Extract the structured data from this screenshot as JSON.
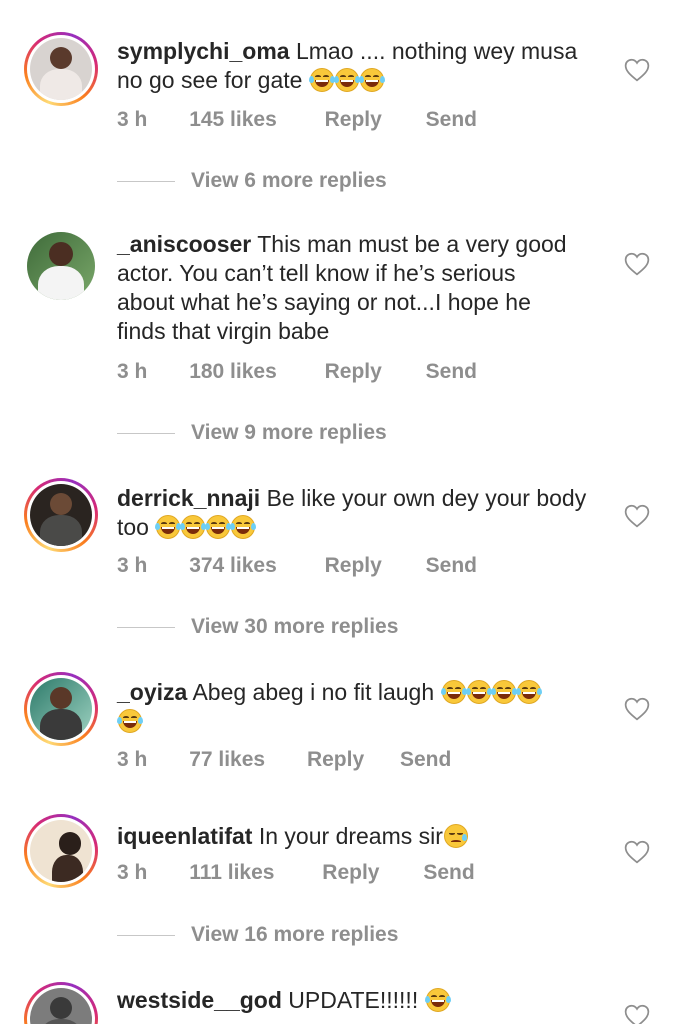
{
  "comments": [
    {
      "username": "symplychi_oma",
      "text_line1": "Lmao .... nothing wey musa",
      "text_line2": "no go see for gate",
      "emoji_count": 3,
      "time": "3 h",
      "likes": "145 likes",
      "reply": "Reply",
      "send": "Send",
      "view_replies": "View 6 more replies"
    },
    {
      "username": "_aniscooser",
      "text_line1": "This man must be a very good",
      "text_line2": "actor. You can’t tell know if he’s serious",
      "text_line3": "about what he’s saying or not...I hope he",
      "text_line4": "finds that virgin babe",
      "time": "3 h",
      "likes": "180 likes",
      "reply": "Reply",
      "send": "Send",
      "view_replies": "View 9 more replies"
    },
    {
      "username": "derrick_nnaji",
      "text_line1": "Be like your own dey your body",
      "text_line2": "too",
      "emoji_count": 4,
      "time": "3 h",
      "likes": "374 likes",
      "reply": "Reply",
      "send": "Send",
      "view_replies": "View 30 more replies"
    },
    {
      "username": "_oyiza",
      "text_line1": "Abeg abeg i no fit laugh",
      "emoji_count": 5,
      "time": "3 h",
      "likes": "77 likes",
      "reply": "Reply",
      "send": "Send"
    },
    {
      "username": "iqueenlatifat",
      "text_line1": "In your dreams sir",
      "time": "3 h",
      "likes": "111 likes",
      "reply": "Reply",
      "send": "Send",
      "view_replies": "View 16 more replies"
    },
    {
      "username": "westside__god",
      "text_line1": "UPDATE!!!!!!"
    }
  ],
  "icons": {
    "like": "heart-outline-icon",
    "laugh": "face-with-tears-of-joy-emoji",
    "sad": "sad-but-relieved-face-emoji"
  },
  "colors": {
    "text": "#262626",
    "meta": "#8e8e8e",
    "story_ring_start": "#feda75",
    "story_ring_end": "#962fbf"
  }
}
